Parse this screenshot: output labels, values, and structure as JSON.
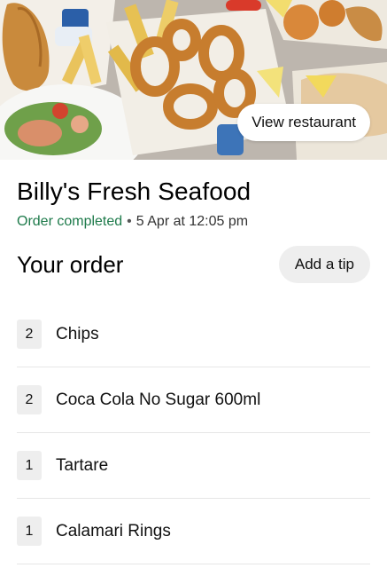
{
  "hero": {
    "image": "fish-and-chips-platter-photo",
    "view_restaurant_label": "View restaurant"
  },
  "restaurant": {
    "name": "Billy's Fresh Seafood",
    "status": "Order completed",
    "separator": "•",
    "datetime": "5 Apr at 12:05 pm"
  },
  "order": {
    "heading": "Your order",
    "add_tip_label": "Add a tip",
    "items": [
      {
        "qty": "2",
        "name": "Chips"
      },
      {
        "qty": "2",
        "name": "Coca Cola No Sugar 600ml"
      },
      {
        "qty": "1",
        "name": "Tartare"
      },
      {
        "qty": "1",
        "name": "Calamari Rings"
      }
    ]
  },
  "colors": {
    "status_green": "#1d7a4a",
    "pill_gray": "#eeeeee"
  }
}
